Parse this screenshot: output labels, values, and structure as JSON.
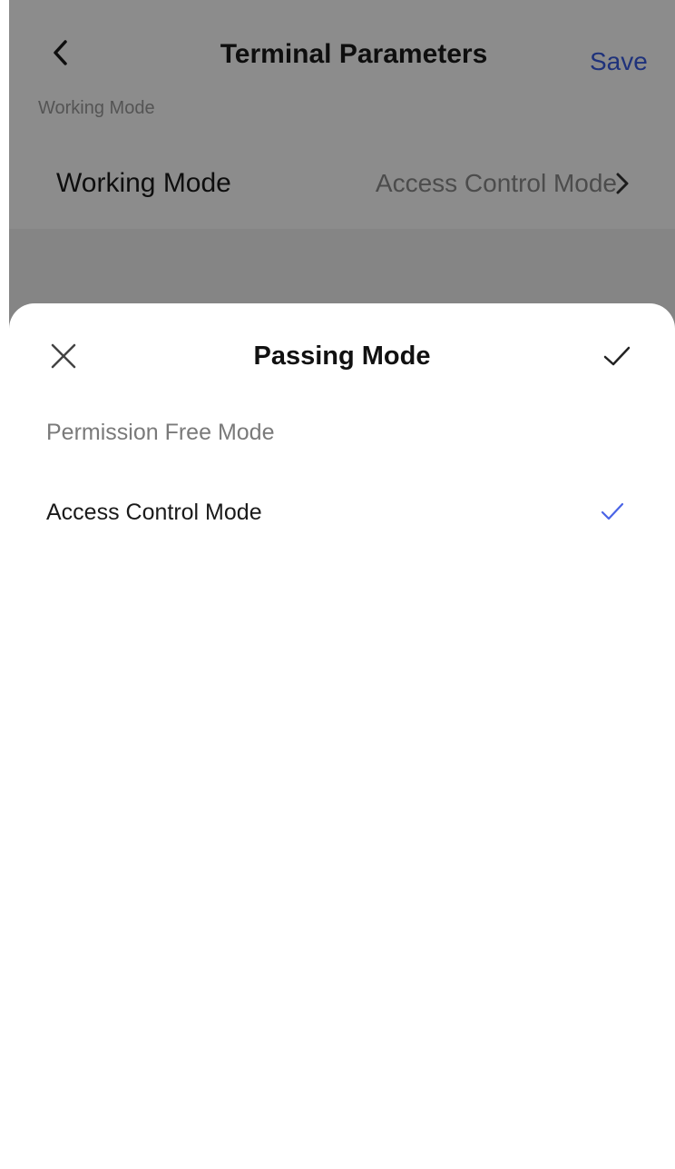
{
  "header": {
    "title": "Terminal Parameters",
    "save_label": "Save"
  },
  "section": {
    "label": "Working Mode"
  },
  "setting": {
    "label": "Working Mode",
    "value": "Access Control Mode"
  },
  "sheet": {
    "title": "Passing Mode",
    "options": [
      {
        "label": "Permission Free Mode",
        "selected": false
      },
      {
        "label": "Access Control Mode",
        "selected": true
      }
    ]
  },
  "colors": {
    "accent": "#3a5ce0",
    "dim_overlay": "rgba(0,0,0,0.45)"
  },
  "icons": {
    "back": "chevron-left-icon",
    "row": "chevron-right-icon",
    "close": "close-icon",
    "confirm": "check-icon",
    "selected": "check-icon"
  }
}
